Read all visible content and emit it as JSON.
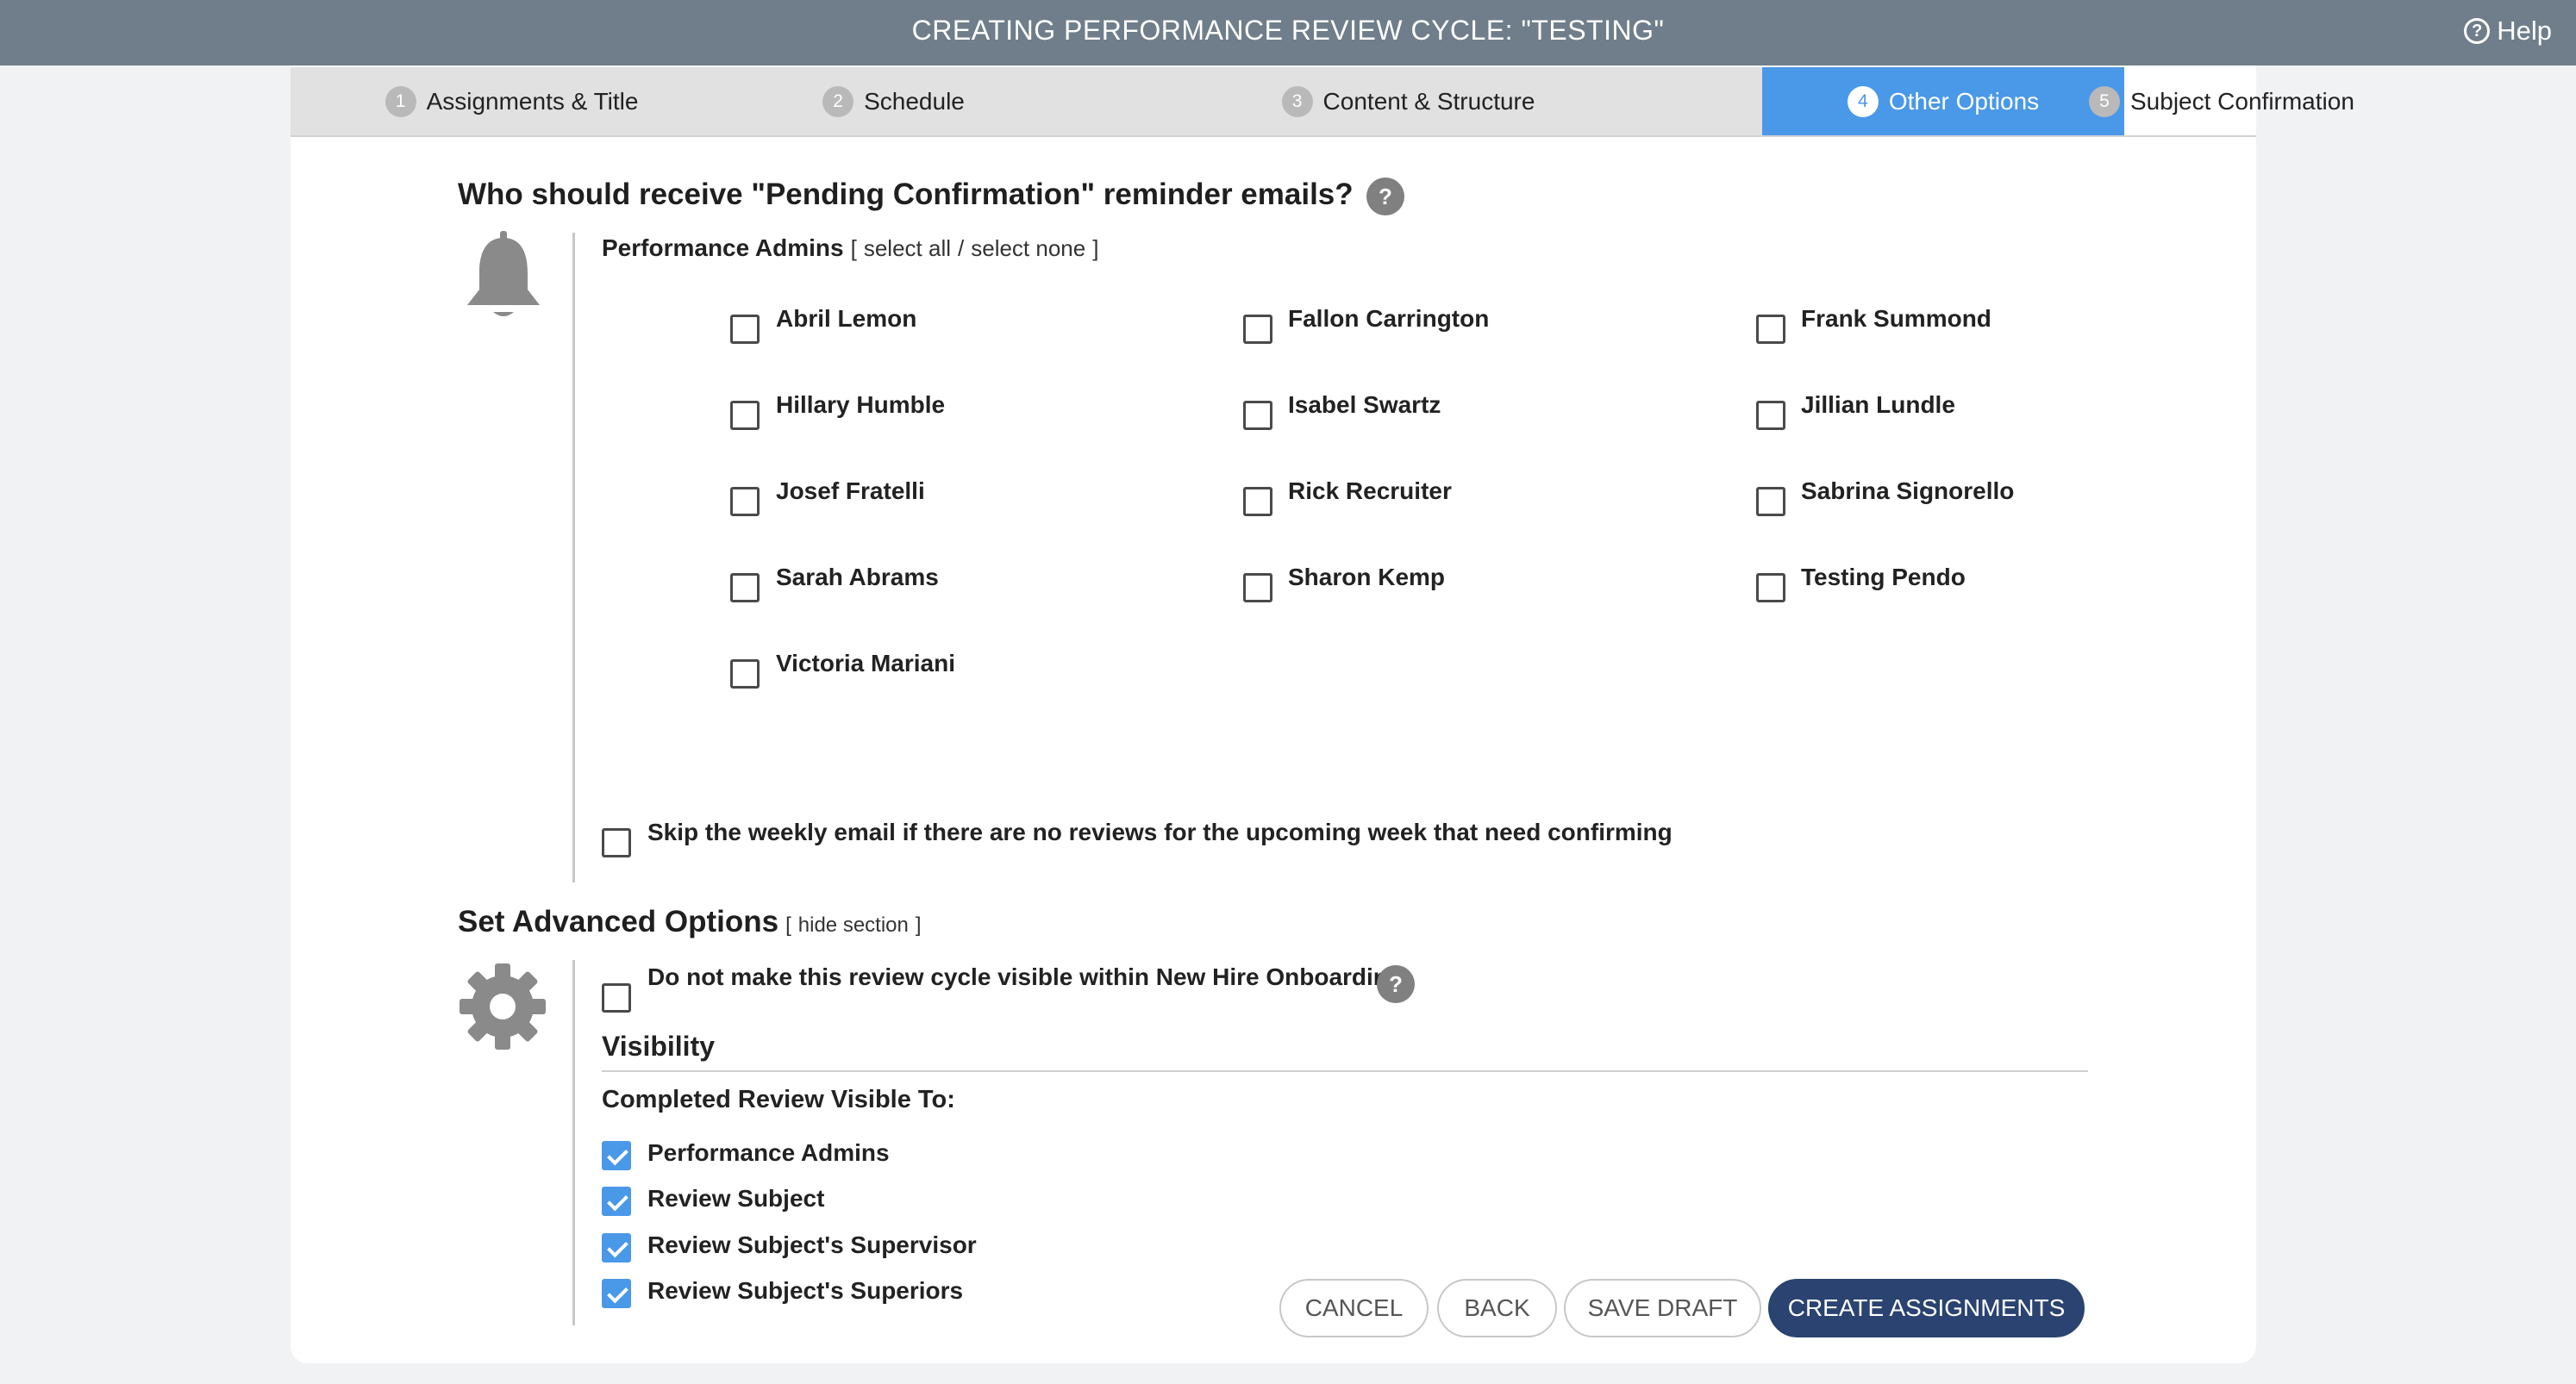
{
  "window": {
    "title": "CREATING PERFORMANCE REVIEW CYCLE: \"TESTING\"",
    "help_label": "Help",
    "help_icon": "question-circle-icon"
  },
  "tabs": [
    {
      "num": "1",
      "label": "Assignments & Title"
    },
    {
      "num": "2",
      "label": "Schedule"
    },
    {
      "num": "3",
      "label": "Content & Structure"
    },
    {
      "num": "4",
      "label": "Other Options",
      "active": true
    },
    {
      "num": "5",
      "label": "Subject Confirmation"
    }
  ],
  "reminders": {
    "heading": "Who should receive \"Pending Confirmation\" reminder emails?",
    "help_glyph": "?",
    "icon": "bell-icon",
    "admins_label": "Performance Admins",
    "bracket_open": "[",
    "select_all": "select all",
    "separator": "/",
    "select_none": "select none",
    "bracket_close": "]",
    "people": [
      "Abril Lemon",
      "Fallon Carrington",
      "Frank Summond",
      "Hillary Humble",
      "Isabel Swartz",
      "Jillian Lundle",
      "Josef Fratelli",
      "Rick Recruiter",
      "Sabrina Signorello",
      "Sarah Abrams",
      "Sharon Kemp",
      "Testing Pendo",
      "Victoria Mariani"
    ],
    "skip_weekly_label": "Skip the weekly email if there are no reviews for the upcoming week that need confirming"
  },
  "advanced": {
    "heading": "Set Advanced Options",
    "bracket_open": "[",
    "hide_section": "hide section",
    "bracket_close": "]",
    "icon": "gear-icon",
    "onboarding_label": "Do not make this review cycle visible within New Hire Onboarding.",
    "help_glyph": "?",
    "visibility_heading": "Visibility",
    "visible_to_label": "Completed Review Visible To:",
    "visible_to": [
      {
        "label": "Performance Admins",
        "checked": true
      },
      {
        "label": "Review Subject",
        "checked": true
      },
      {
        "label": "Review Subject's Supervisor",
        "checked": true
      },
      {
        "label": "Review Subject's Superiors",
        "checked": true
      }
    ]
  },
  "footer": {
    "cancel": "CANCEL",
    "back": "BACK",
    "save_draft": "SAVE DRAFT",
    "create": "CREATE ASSIGNMENTS"
  },
  "colors": {
    "topbar": "#6f7e8a",
    "active_tab": "#4a98e8",
    "primary_button": "#2a4370",
    "link": "#3a7bc4"
  }
}
